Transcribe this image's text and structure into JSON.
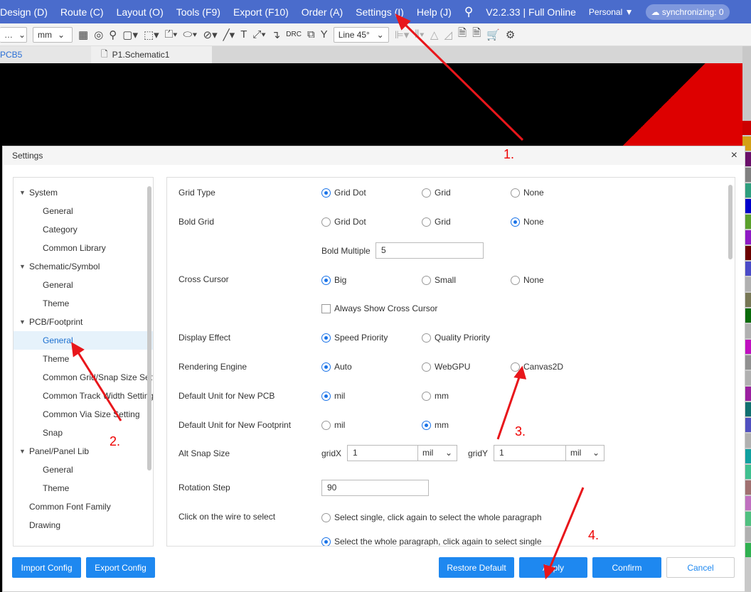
{
  "menu": [
    "Design (D)",
    "Route (C)",
    "Layout (O)",
    "Tools (F9)",
    "Export (F10)",
    "Order (A)",
    "Settings (I)",
    "Help (J)"
  ],
  "version": "V2.2.33 | Full Online",
  "account": "Personal",
  "sync": "synchronizing: 0",
  "toolbar": {
    "unit": "mm",
    "line_mode": "Line 45°",
    "drc": "DRC"
  },
  "tabs": [
    "PCB5",
    "P1.Schematic1"
  ],
  "strip_colors": [
    "#cc0000",
    "#d4a017",
    "#6a0f6a",
    "#808080",
    "#2e9e7e",
    "#0000cc",
    "#5aa02c",
    "#8e1ac4",
    "#6b0000",
    "#4b4bc8",
    "#b0b0b0",
    "#777755",
    "#0a6a0a",
    "#b0b0b0",
    "#c010c0",
    "#909090",
    "#b0b0b0",
    "#9a20a0",
    "#107070",
    "#5050c0",
    "#b0b0b0",
    "#10a0a0",
    "#40c090",
    "#a07070",
    "#c070c0",
    "#50c080",
    "#b0b0b0",
    "#30b050"
  ],
  "dialog": {
    "title": "Settings",
    "tree": [
      {
        "label": "System",
        "level": 0,
        "caret": true
      },
      {
        "label": "General",
        "level": 1
      },
      {
        "label": "Category",
        "level": 1
      },
      {
        "label": "Common Library",
        "level": 1
      },
      {
        "label": "Schematic/Symbol",
        "level": 0,
        "caret": true
      },
      {
        "label": "General",
        "level": 1
      },
      {
        "label": "Theme",
        "level": 1
      },
      {
        "label": "PCB/Footprint",
        "level": 0,
        "caret": true
      },
      {
        "label": "General",
        "level": 1,
        "selected": true
      },
      {
        "label": "Theme",
        "level": 1
      },
      {
        "label": "Common Grid/Snap Size Setting",
        "level": 1
      },
      {
        "label": "Common Track Width Setting",
        "level": 1
      },
      {
        "label": "Common Via Size Setting",
        "level": 1
      },
      {
        "label": "Snap",
        "level": 1
      },
      {
        "label": "Panel/Panel Lib",
        "level": 0,
        "caret": true
      },
      {
        "label": "General",
        "level": 1
      },
      {
        "label": "Theme",
        "level": 1
      },
      {
        "label": "Common Font Family",
        "level": 0
      },
      {
        "label": "Drawing",
        "level": 0
      }
    ],
    "settings": {
      "grid_type": {
        "label": "Grid Type",
        "options": [
          "Grid Dot",
          "Grid",
          "None"
        ],
        "selected": 0
      },
      "bold_grid": {
        "label": "Bold Grid",
        "options": [
          "Grid Dot",
          "Grid",
          "None"
        ],
        "selected": 2
      },
      "bold_multiple": {
        "label": "Bold Multiple",
        "value": "5"
      },
      "cross_cursor": {
        "label": "Cross Cursor",
        "options": [
          "Big",
          "Small",
          "None"
        ],
        "selected": 0
      },
      "always_show": {
        "label": "Always Show Cross Cursor",
        "checked": false
      },
      "display_effect": {
        "label": "Display Effect",
        "options": [
          "Speed Priority",
          "Quality Priority"
        ],
        "selected": 0
      },
      "rendering_engine": {
        "label": "Rendering Engine",
        "options": [
          "Auto",
          "WebGPU",
          "Canvas2D"
        ],
        "selected": 0
      },
      "unit_pcb": {
        "label": "Default Unit for New PCB",
        "options": [
          "mil",
          "mm"
        ],
        "selected": 0
      },
      "unit_fp": {
        "label": "Default Unit for New Footprint",
        "options": [
          "mil",
          "mm"
        ],
        "selected": 1
      },
      "alt_snap": {
        "label": "Alt Snap Size",
        "gridx_label": "gridX",
        "gridx": "1",
        "gridx_unit": "mil",
        "gridy_label": "gridY",
        "gridy": "1",
        "gridy_unit": "mil"
      },
      "rotation": {
        "label": "Rotation Step",
        "value": "90"
      },
      "wire_select": {
        "label": "Click on the wire to select",
        "options": [
          "Select single, click again to select the whole paragraph",
          "Select the whole paragraph, click again to select single"
        ],
        "selected": 1
      }
    },
    "buttons": {
      "import": "Import Config",
      "export": "Export Config",
      "restore": "Restore Default",
      "apply": "Apply",
      "confirm": "Confirm",
      "cancel": "Cancel"
    }
  },
  "annotations": [
    "1.",
    "2.",
    "3.",
    "4."
  ]
}
